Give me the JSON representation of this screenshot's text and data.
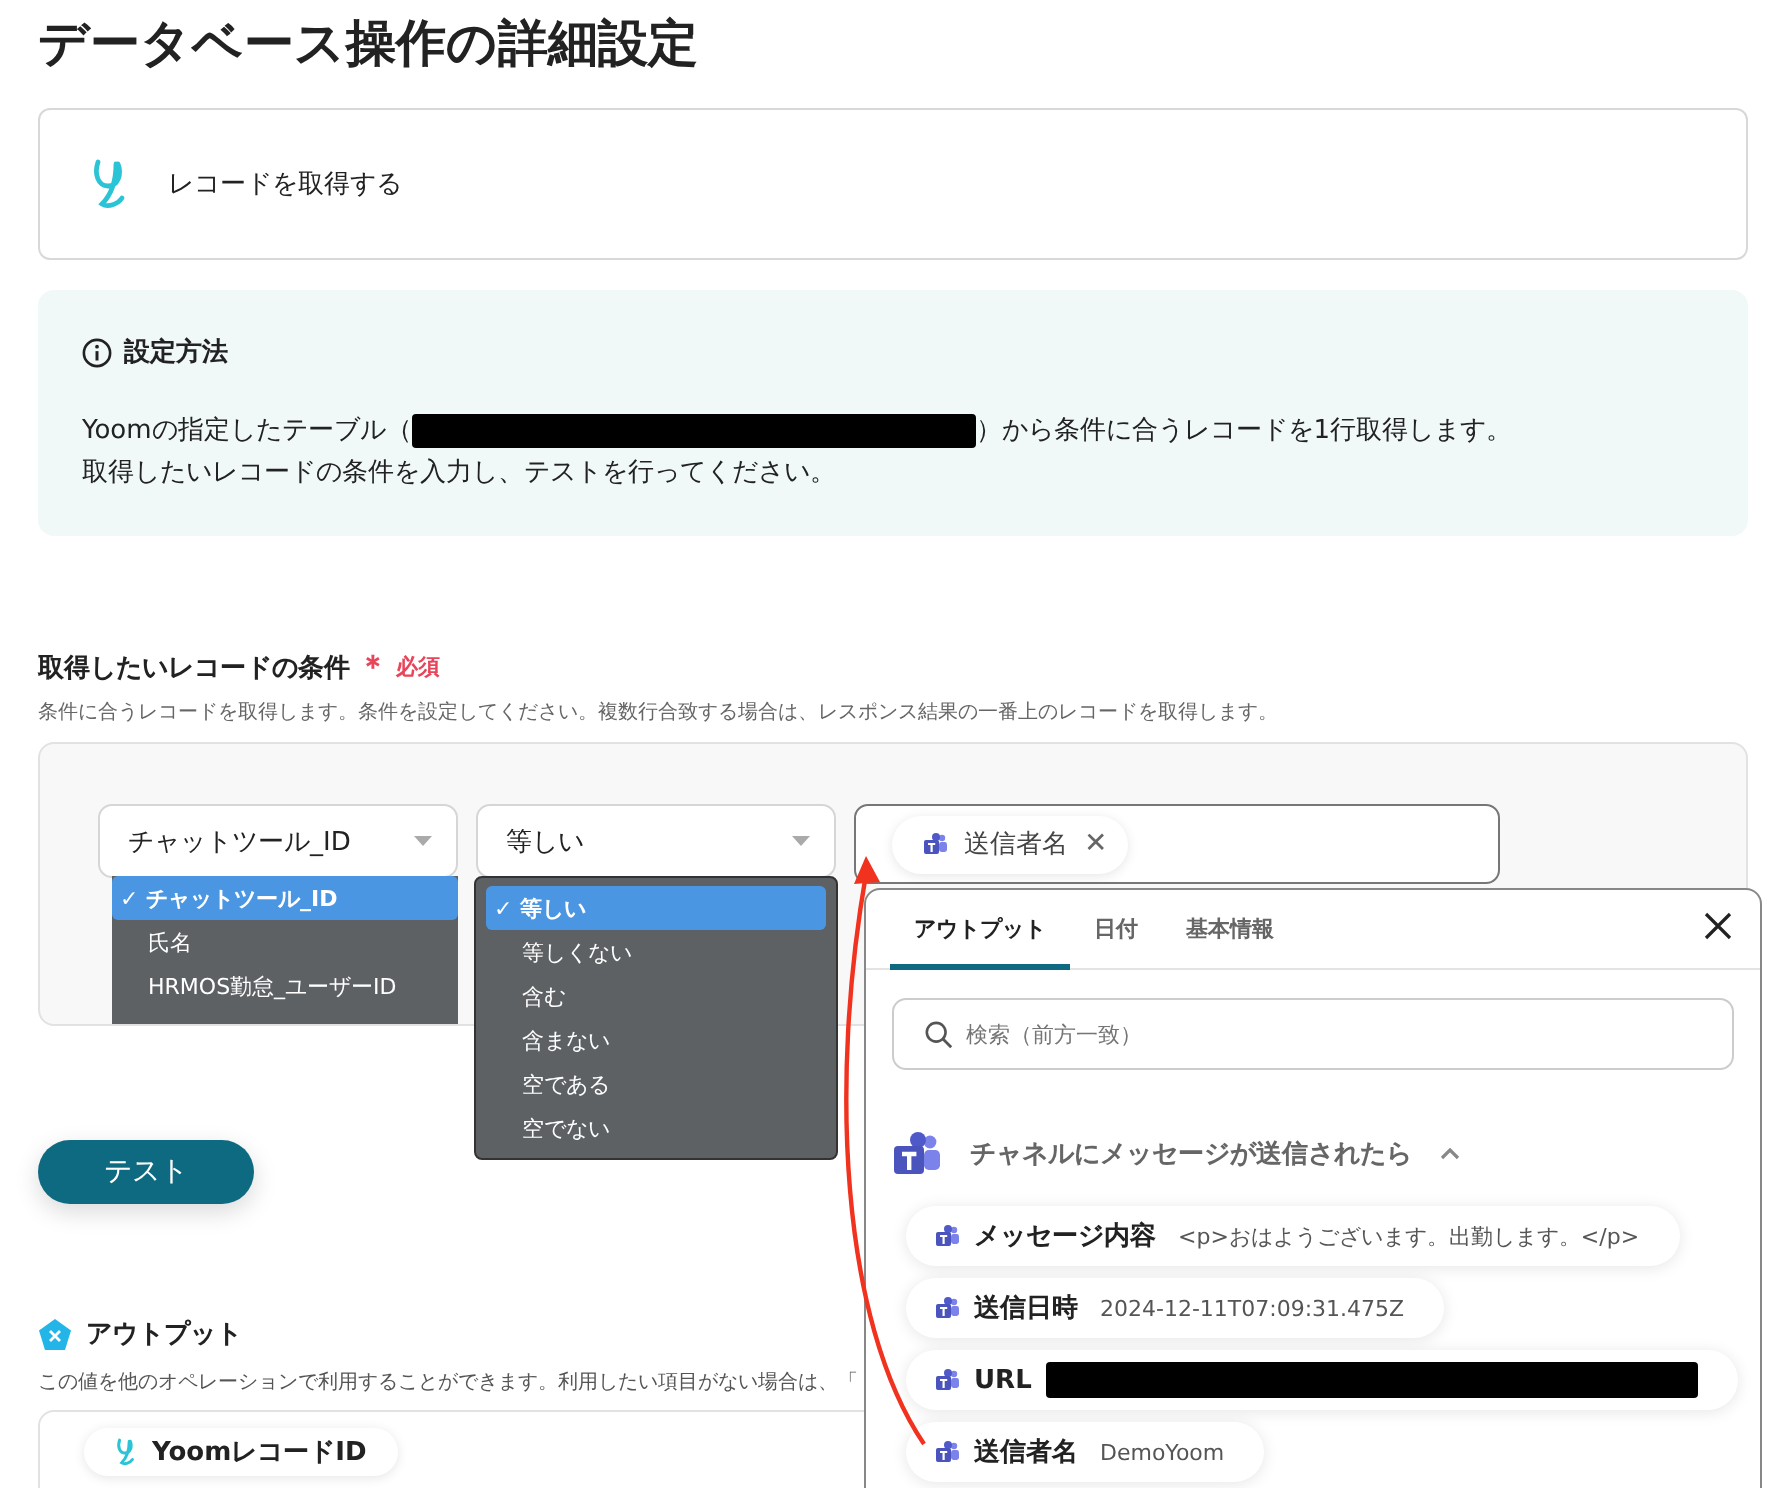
{
  "page_title": "データベース操作の詳細設定",
  "action_card": {
    "label": "レコードを取得する"
  },
  "info": {
    "heading": "設定方法",
    "line1_before": "Yoomの指定したテーブル（",
    "line1_after": "）から条件に合うレコードを1行取得します。",
    "line2": "取得したいレコードの条件を入力し、テストを行ってください。"
  },
  "condition": {
    "label": "取得したいレコードの条件",
    "required_mark": "＊",
    "required_text": "必須",
    "description": "条件に合うレコードを取得します。条件を設定してください。複数行合致する場合は、レスポンス結果の一番上のレコードを取得します。",
    "field_select": {
      "value": "チャットツール_ID",
      "check_mark": "✓",
      "options": [
        {
          "label": "チャットツール_ID",
          "selected": true
        },
        {
          "label": "氏名",
          "selected": false
        },
        {
          "label": "HRMOS勤怠_ユーザーID",
          "selected": false
        }
      ]
    },
    "operator_select": {
      "value": "等しい",
      "check_mark": "✓",
      "options": [
        {
          "label": "等しい",
          "selected": true
        },
        {
          "label": "等しくない",
          "selected": false
        },
        {
          "label": "含む",
          "selected": false
        },
        {
          "label": "含まない",
          "selected": false
        },
        {
          "label": "空である",
          "selected": false
        },
        {
          "label": "空でない",
          "selected": false
        }
      ]
    },
    "value_field": {
      "tag": "送信者名",
      "remove": "✕"
    }
  },
  "test_button": "テスト",
  "output": {
    "heading": "アウトプット",
    "description": "この値を他のオペレーションで利用することができます。利用したい項目がない場合は、「",
    "items": [
      "YoomレコードID"
    ]
  },
  "picker": {
    "tabs": [
      {
        "label": "アウトプット",
        "selected": true
      },
      {
        "label": "日付",
        "selected": false
      },
      {
        "label": "基本情報",
        "selected": false
      }
    ],
    "search": {
      "placeholder": "検索（前方一致）"
    },
    "group": {
      "title": "チャネルにメッセージが送信されたら",
      "expanded": true
    },
    "items": [
      {
        "label": "メッセージ内容",
        "value": "<p>おはようございます。出勤します。</p>",
        "redacted": false
      },
      {
        "label": "送信日時",
        "value": "2024-12-11T07:09:31.475Z",
        "redacted": false
      },
      {
        "label": "URL",
        "redacted": true
      },
      {
        "label": "送信者名",
        "value": "DemoYoom",
        "redacted": false
      }
    ]
  }
}
